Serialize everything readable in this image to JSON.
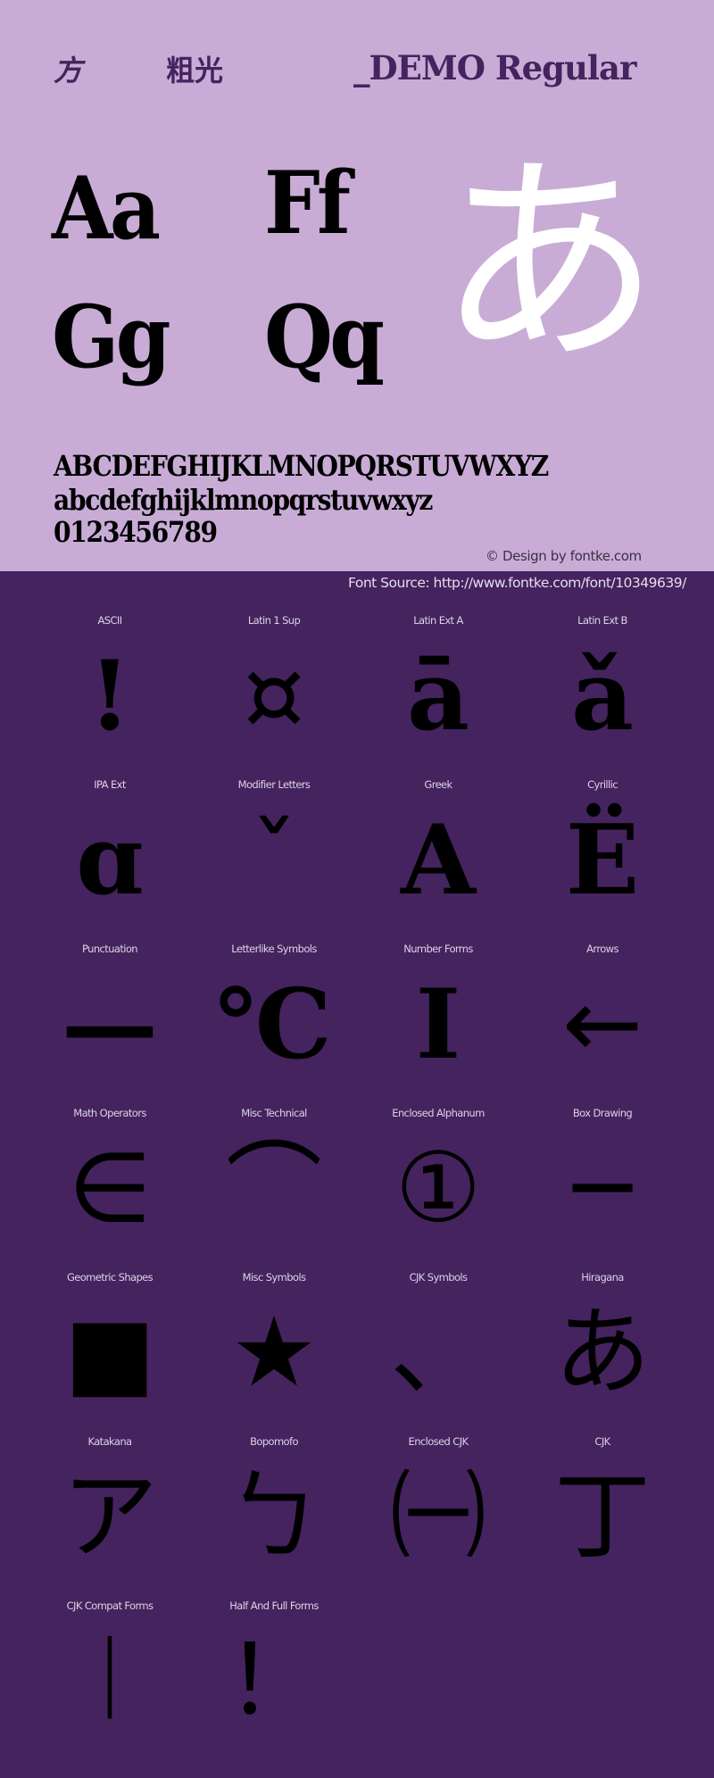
{
  "header": {
    "title_cjk_part1": "方",
    "title_cjk_part2": "粗光",
    "title_latin": "_DEMO Regular",
    "sample_pairs": [
      "Aa",
      "Ff",
      "Gg",
      "Qq"
    ],
    "hero_glyph": "あ",
    "uppercase": "ABCDEFGHIJKLMNOPQRSTUVWXYZ",
    "lowercase": "abcdefghijklmnopqrstuvwxyz",
    "digits": "0123456789",
    "credit": "© Design by fontke.com",
    "source": "Font Source: http://www.fontke.com/font/10349639/"
  },
  "colors": {
    "hero_background": "#c8acd6",
    "grid_background": "#44235e",
    "title_color": "#44235e",
    "hero_glyph_color": "#ffffff",
    "glyph_color": "#000000"
  },
  "blocks": [
    {
      "label": "ASCII",
      "glyph": "!"
    },
    {
      "label": "Latin 1 Sup",
      "glyph": "¤"
    },
    {
      "label": "Latin Ext A",
      "glyph": "ā"
    },
    {
      "label": "Latin Ext B",
      "glyph": "ǎ"
    },
    {
      "label": "IPA Ext",
      "glyph": "ɑ"
    },
    {
      "label": "Modifier Letters",
      "glyph": "ˇ"
    },
    {
      "label": "Greek",
      "glyph": "Α"
    },
    {
      "label": "Cyrillic",
      "glyph": "Ё"
    },
    {
      "label": "Punctuation",
      "glyph": "—"
    },
    {
      "label": "Letterlike Symbols",
      "glyph": "℃"
    },
    {
      "label": "Number Forms",
      "glyph": "Ⅰ"
    },
    {
      "label": "Arrows",
      "glyph": "←"
    },
    {
      "label": "Math Operators",
      "glyph": "∈"
    },
    {
      "label": "Misc Technical",
      "glyph": "⌒"
    },
    {
      "label": "Enclosed Alphanum",
      "glyph": "①"
    },
    {
      "label": "Box Drawing",
      "glyph": "─"
    },
    {
      "label": "Geometric Shapes",
      "glyph": "■"
    },
    {
      "label": "Misc Symbols",
      "glyph": "★"
    },
    {
      "label": "CJK Symbols",
      "glyph": "、"
    },
    {
      "label": "Hiragana",
      "glyph": "あ"
    },
    {
      "label": "Katakana",
      "glyph": "ア"
    },
    {
      "label": "Bopomofo",
      "glyph": "ㄅ"
    },
    {
      "label": "Enclosed CJK",
      "glyph": "㈠"
    },
    {
      "label": "CJK",
      "glyph": "丁"
    },
    {
      "label": "CJK Compat Forms",
      "glyph": "︱"
    },
    {
      "label": "Half And Full Forms",
      "glyph": "！"
    }
  ]
}
